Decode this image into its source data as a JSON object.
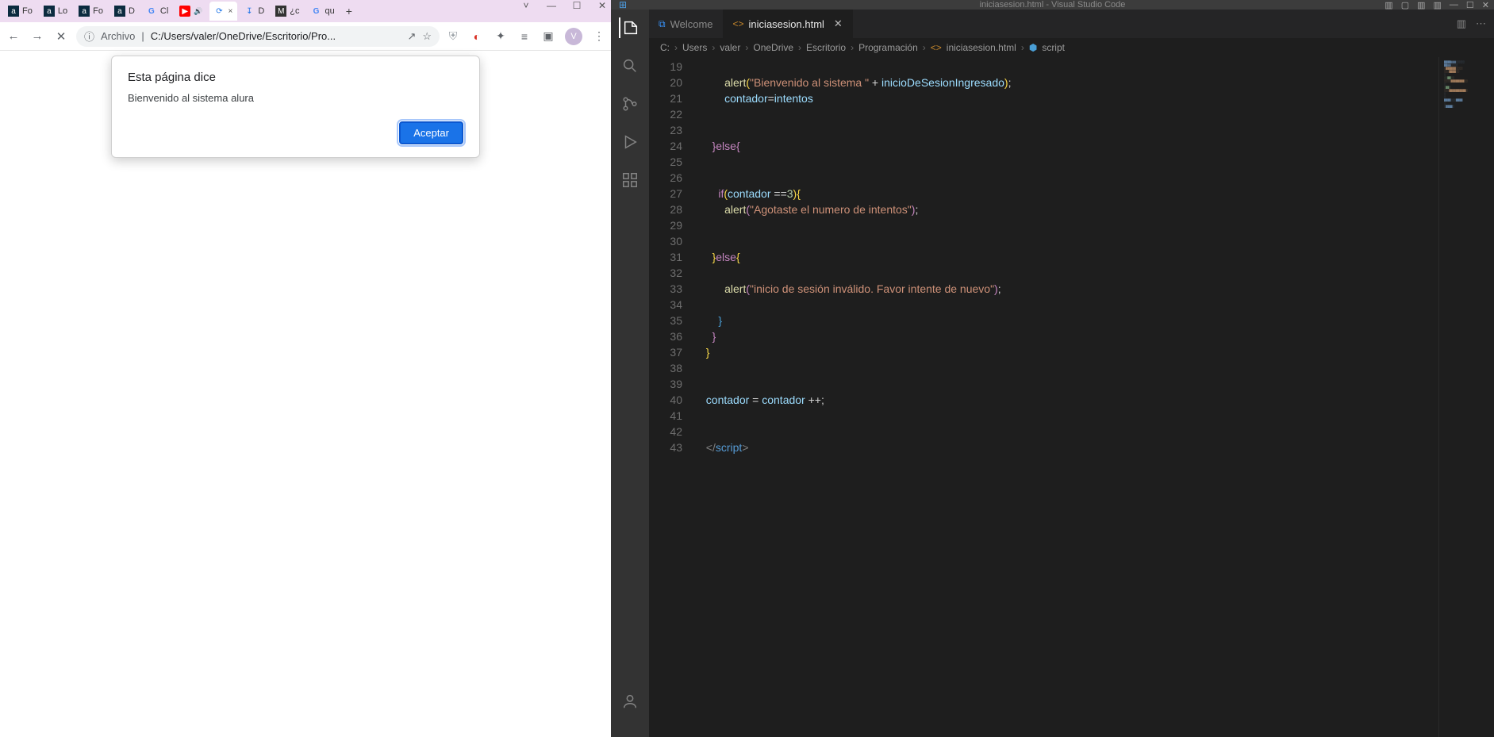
{
  "browser": {
    "tabs": [
      {
        "label": "Fo",
        "tip": "a"
      },
      {
        "label": "Lo",
        "tip": "a"
      },
      {
        "label": "Fo",
        "tip": "a"
      },
      {
        "label": "D",
        "tip": "a"
      },
      {
        "label": "Cl",
        "tip": "G"
      },
      {
        "label": "",
        "tip": "▶"
      },
      {
        "label": "×",
        "tip": "⟳"
      },
      {
        "label": "D",
        "tip": "↧"
      },
      {
        "label": "¿c",
        "tip": "M"
      },
      {
        "label": "qu",
        "tip": "G"
      }
    ],
    "newtab": "+",
    "win": {
      "down": "˅",
      "min": "—",
      "max": "☐",
      "close": "✕"
    },
    "nav": {
      "back": "←",
      "fwd": "→",
      "stop": "✕"
    },
    "omnibox": {
      "scheme_icon": "ⓘ",
      "scheme_label": "Archivo",
      "sep": "|",
      "url": "C:/Users/valer/OneDrive/Escritorio/Pro...",
      "share": "↗",
      "star": "☆"
    },
    "right": {
      "shield": "⛨",
      "block": "◐",
      "ext": "✦",
      "list": "≡",
      "panel": "▣",
      "avatar": "V",
      "menu": "⋮"
    },
    "alert": {
      "title": "Esta página dice",
      "message": "Bienvenido al sistema alura",
      "accept": "Aceptar"
    }
  },
  "vscode": {
    "title": "iniciasesion.html - Visual Studio Code",
    "title_left_icon": "⊞",
    "title_right": [
      "▥",
      "▢",
      "▥",
      "▥",
      "—",
      "☐",
      "✕"
    ],
    "activity": [
      "files",
      "search",
      "git",
      "debug",
      "ext"
    ],
    "account_icon": "◔",
    "tabs": {
      "welcome": "Welcome",
      "file": "iniciasesion.html",
      "close": "✕"
    },
    "tab_right": {
      "split": "▥",
      "more": "⋯"
    },
    "breadcrumb": [
      "C:",
      "Users",
      "valer",
      "OneDrive",
      "Escritorio",
      "Programación",
      "iniciasesion.html",
      "script"
    ],
    "lines": {
      "start": 19,
      "end": 43,
      "l20": {
        "a": "alert",
        "p": "(",
        "s1": "\"Bienvenido al sistema \"",
        "plus": " + ",
        "v": "inicioDeSesionIngresado",
        "cp": ")",
        "sc": ";"
      },
      "l21": {
        "v1": "contador",
        "eq": "=",
        "v2": "intentos"
      },
      "l24": {
        "b1": "}",
        "kw": "else",
        "b2": "{"
      },
      "l27": {
        "kw": "if",
        "p": "(",
        "v": "contador",
        "op": " ==",
        "n": "3",
        "cp": ")",
        "b": "{"
      },
      "l28": {
        "a": "alert",
        "p": "(",
        "s": "\"Agotaste el numero de intentos\"",
        "cp": ")",
        "sc": ";"
      },
      "l31": {
        "b1": "}",
        "kw": "else",
        "b2": "{"
      },
      "l33": {
        "a": "alert",
        "p": "(",
        "s": "\"inicio de sesión inválido. Favor intente de nuevo\"",
        "cp": ")",
        "sc": ";"
      },
      "l35": "}",
      "l36": "}",
      "l37": "}",
      "l40": {
        "v1": "contador",
        "eq": " = ",
        "v2": "contador",
        "op": " ++",
        "sc": ";"
      },
      "l43": {
        "o": "</",
        "t": "script",
        "c": ">"
      }
    }
  }
}
